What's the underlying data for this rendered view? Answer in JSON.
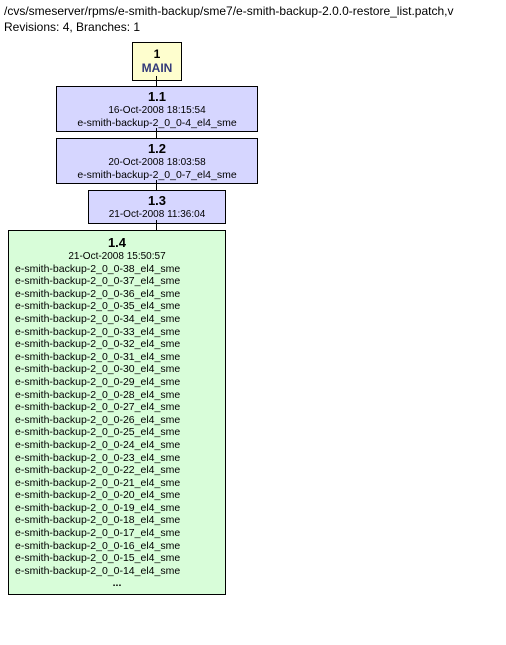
{
  "header": {
    "path": "/cvs/smeserver/rpms/e-smith-backup/sme7/e-smith-backup-2.0.0-restore_list.patch,v",
    "meta": "Revisions: 4, Branches: 1"
  },
  "branch": {
    "num": "1",
    "label": "MAIN"
  },
  "revisions": [
    {
      "num": "1.1",
      "date": "16-Oct-2008 18:15:54",
      "tags": [
        "e-smith-backup-2_0_0-4_el4_sme"
      ]
    },
    {
      "num": "1.2",
      "date": "20-Oct-2008 18:03:58",
      "tags": [
        "e-smith-backup-2_0_0-7_el4_sme"
      ]
    },
    {
      "num": "1.3",
      "date": "21-Oct-2008 11:36:04",
      "tags": []
    },
    {
      "num": "1.4",
      "date": "21-Oct-2008 15:50:57",
      "tags": [
        "e-smith-backup-2_0_0-38_el4_sme",
        "e-smith-backup-2_0_0-37_el4_sme",
        "e-smith-backup-2_0_0-36_el4_sme",
        "e-smith-backup-2_0_0-35_el4_sme",
        "e-smith-backup-2_0_0-34_el4_sme",
        "e-smith-backup-2_0_0-33_el4_sme",
        "e-smith-backup-2_0_0-32_el4_sme",
        "e-smith-backup-2_0_0-31_el4_sme",
        "e-smith-backup-2_0_0-30_el4_sme",
        "e-smith-backup-2_0_0-29_el4_sme",
        "e-smith-backup-2_0_0-28_el4_sme",
        "e-smith-backup-2_0_0-27_el4_sme",
        "e-smith-backup-2_0_0-26_el4_sme",
        "e-smith-backup-2_0_0-25_el4_sme",
        "e-smith-backup-2_0_0-24_el4_sme",
        "e-smith-backup-2_0_0-23_el4_sme",
        "e-smith-backup-2_0_0-22_el4_sme",
        "e-smith-backup-2_0_0-21_el4_sme",
        "e-smith-backup-2_0_0-20_el4_sme",
        "e-smith-backup-2_0_0-19_el4_sme",
        "e-smith-backup-2_0_0-18_el4_sme",
        "e-smith-backup-2_0_0-17_el4_sme",
        "e-smith-backup-2_0_0-16_el4_sme",
        "e-smith-backup-2_0_0-15_el4_sme",
        "e-smith-backup-2_0_0-14_el4_sme"
      ],
      "ellipsis": "..."
    }
  ],
  "chart_data": {
    "type": "tree",
    "title": "CVS revision graph",
    "branch": "MAIN (1)",
    "nodes": [
      "1.1",
      "1.2",
      "1.3",
      "1.4"
    ],
    "edges": [
      [
        "MAIN",
        "1.1"
      ],
      [
        "1.1",
        "1.2"
      ],
      [
        "1.2",
        "1.3"
      ],
      [
        "1.3",
        "1.4"
      ]
    ]
  }
}
